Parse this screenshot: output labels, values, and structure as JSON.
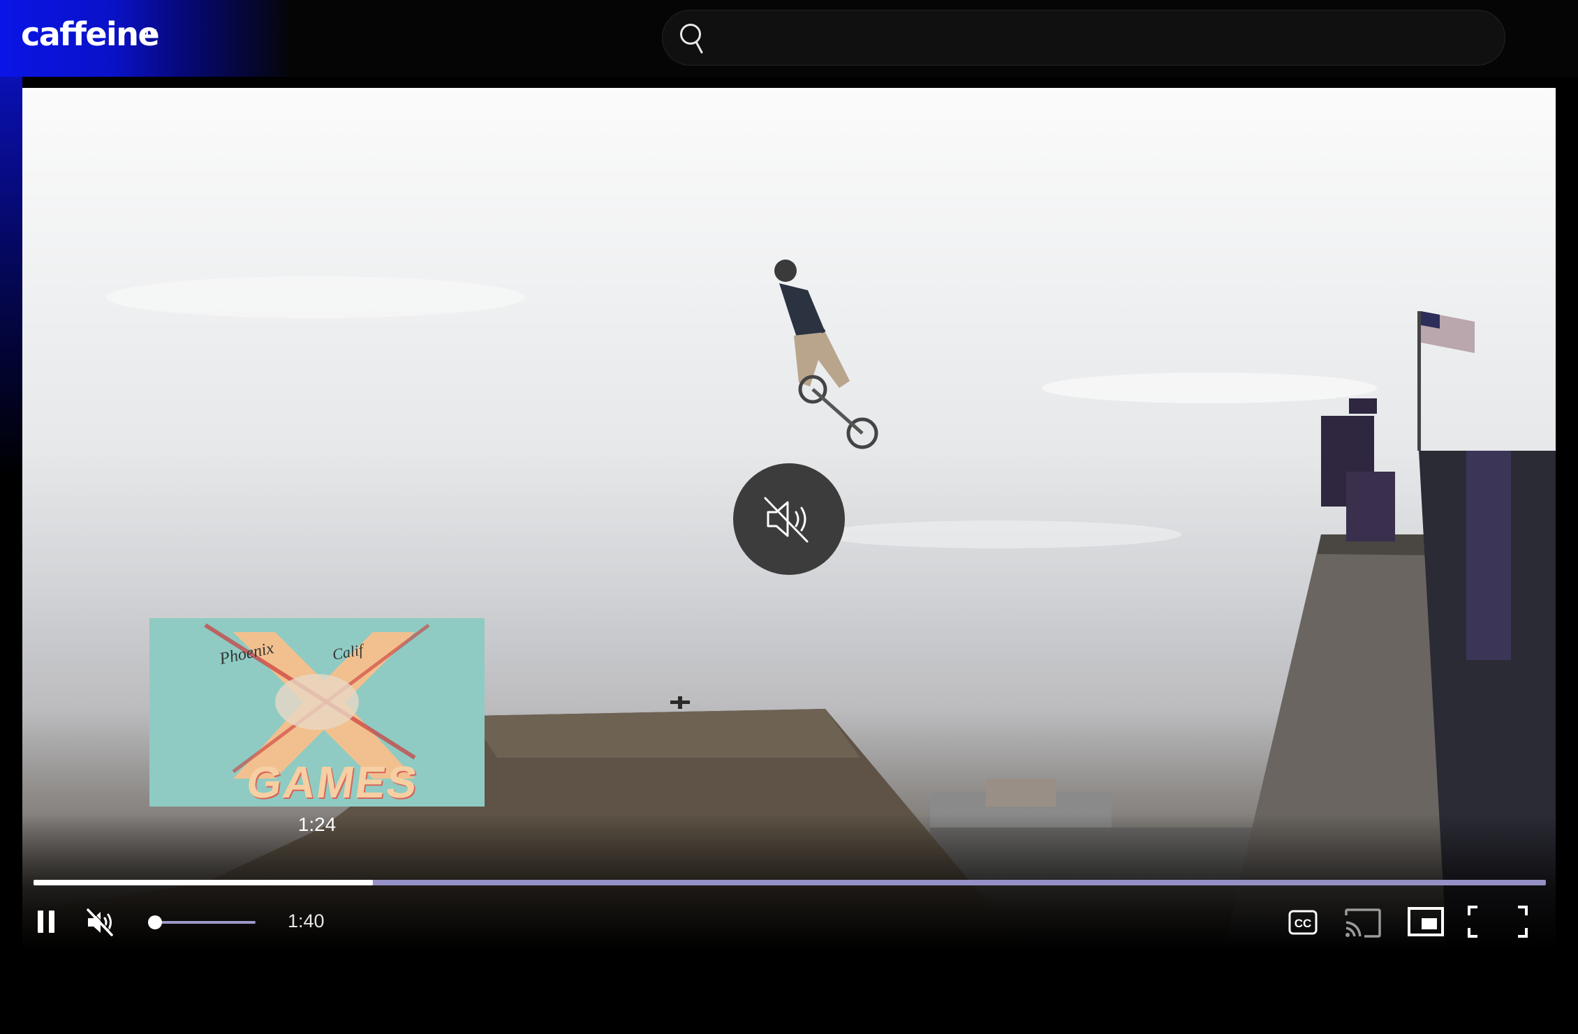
{
  "header": {
    "logo_text": "caffeine",
    "logo_superscript": "tv",
    "search": {
      "placeholder": "",
      "value": "",
      "icon": "search-icon"
    }
  },
  "video": {
    "center_overlay_icon": "volume-muted-icon",
    "preview": {
      "time": "1:24",
      "thumbnail_text": [
        "Phoenix",
        "Calif",
        "GAMES"
      ]
    }
  },
  "player": {
    "progress_fraction": 0.2245,
    "volume_fraction": 0.0,
    "current_time": "1:40",
    "controls": {
      "play_pause_icon": "pause-icon",
      "mute_icon": "volume-muted-icon",
      "cc_label": "CC",
      "cast_icon": "cast-icon",
      "pip_icon": "picture-in-picture-icon",
      "fullscreen_icon": "fullscreen-icon"
    }
  },
  "colors": {
    "brand_blue": "#0a14e6",
    "progress_played": "#ffffff",
    "progress_remaining": "#9591c6",
    "overlay_button": "#3c3c3c"
  }
}
